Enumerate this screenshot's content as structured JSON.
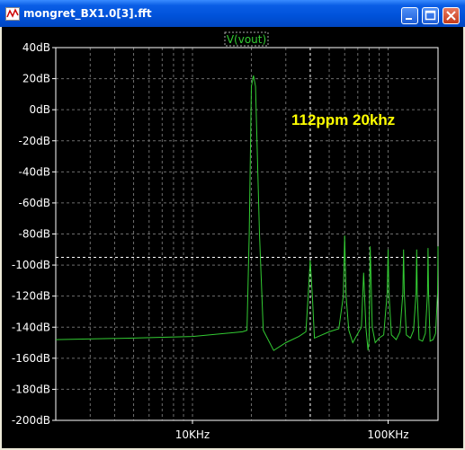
{
  "window": {
    "title": "mongret_BX1.0[3].fft",
    "icon": "waveform-app-icon"
  },
  "title_buttons": {
    "minimize": "minimize-icon",
    "maximize": "maximize-icon",
    "close": "close-icon"
  },
  "colors": {
    "trace": "#33cc33",
    "annotation": "#ffff00",
    "axis": "#ffffff",
    "grid": "#6e6e6e",
    "background": "#000000"
  },
  "chart_data": {
    "type": "line",
    "legend": "V(vout)",
    "annotation": "112ppm 20khz",
    "x_scale": "log",
    "xlim_hz": [
      2000,
      180000
    ],
    "ylim_db": [
      -200,
      40
    ],
    "y_ticks": [
      "40dB",
      "20dB",
      "0dB",
      "-20dB",
      "-40dB",
      "-60dB",
      "-80dB",
      "-100dB",
      "-120dB",
      "-140dB",
      "-160dB",
      "-180dB",
      "-200dB"
    ],
    "x_ticks": [
      "10KHz",
      "100KHz"
    ],
    "cursor": {
      "x_hz": 40000,
      "y_db": -95
    },
    "series": [
      {
        "x": [
          2000,
          5000,
          10000,
          18000,
          19000,
          19500,
          20000,
          20500,
          21000,
          22000,
          23000,
          26000,
          30000,
          35000,
          38000,
          39000,
          40000,
          41000,
          42000,
          50000,
          56000,
          59000,
          60000,
          61000,
          63000,
          66000,
          70000,
          73000,
          75000,
          77000,
          79000,
          80000,
          81000,
          83000,
          86000,
          90000,
          95000,
          99000,
          100000,
          101000,
          104000,
          110000,
          115000,
          119000,
          120000,
          121000,
          124000,
          130000,
          135000,
          139000,
          140000,
          141000,
          144000,
          150000,
          155000,
          159000,
          160000,
          161000,
          164000,
          170000,
          175000,
          179000,
          180000
        ],
        "y": [
          -148,
          -147,
          -146,
          -143,
          -142,
          -80,
          15,
          22,
          15,
          -80,
          -142,
          -155,
          -150,
          -146,
          -143,
          -120,
          -97,
          -120,
          -147,
          -143,
          -141,
          -120,
          -81,
          -120,
          -142,
          -150,
          -144,
          -140,
          -105,
          -140,
          -155,
          -148,
          -88,
          -140,
          -150,
          -147,
          -145,
          -118,
          -90,
          -118,
          -145,
          -148,
          -143,
          -118,
          -90,
          -118,
          -145,
          -147,
          -142,
          -118,
          -90,
          -118,
          -148,
          -149,
          -144,
          -118,
          -89,
          -118,
          -149,
          -148,
          -144,
          -118,
          -88
        ]
      }
    ]
  }
}
